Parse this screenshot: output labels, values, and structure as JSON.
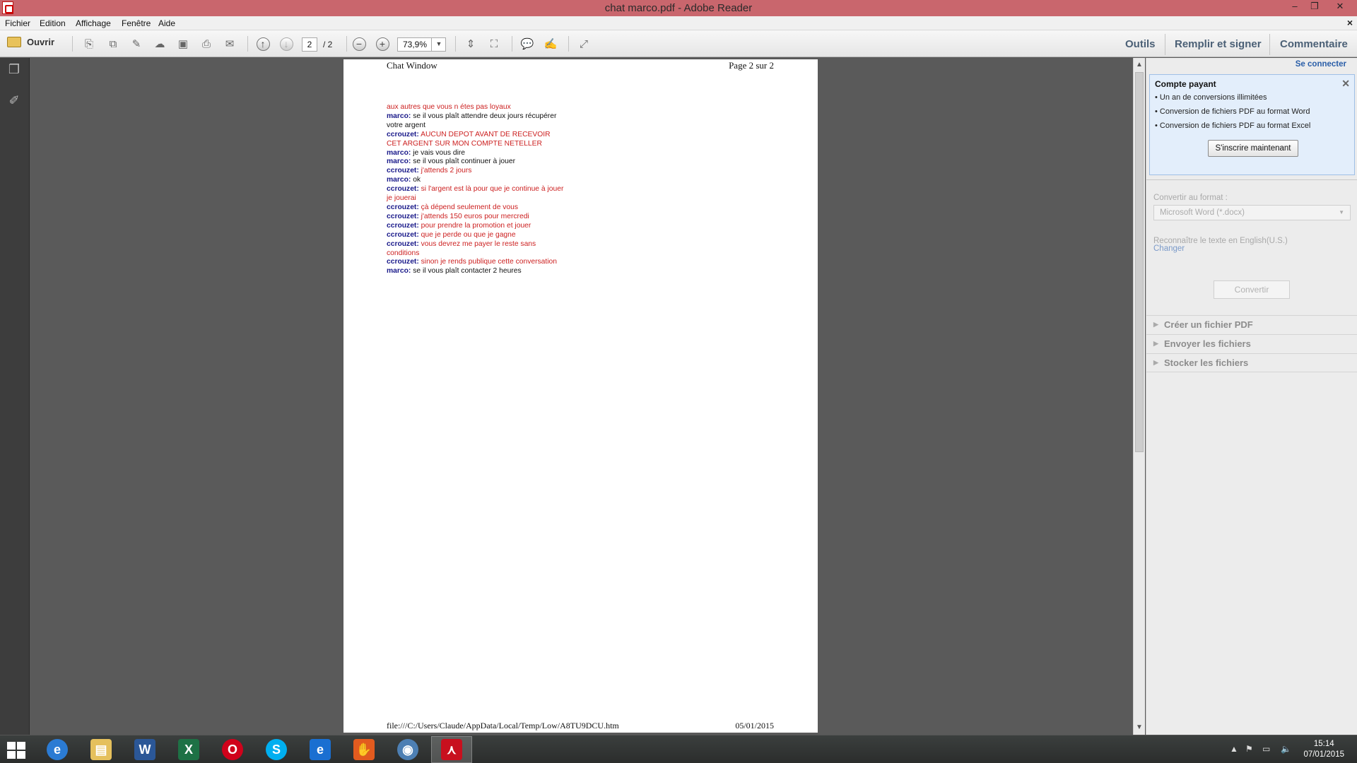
{
  "window": {
    "title": "chat marco.pdf - Adobe Reader",
    "min": "–",
    "restore": "❐",
    "close": "✕"
  },
  "menu": {
    "items": [
      "Fichier",
      "Edition",
      "Affichage",
      "Fenêtre",
      "Aide"
    ],
    "close_doc": "×"
  },
  "toolbar": {
    "open_label": "Ouvrir",
    "page_current": "2",
    "page_total": "/ 2",
    "zoom": "73,9%",
    "tabs": [
      "Outils",
      "Remplir et signer",
      "Commentaire"
    ]
  },
  "document": {
    "header_left": "Chat Window",
    "header_right": "Page 2 sur 2",
    "footer_left": "file:///C:/Users/Claude/AppData/Local/Temp/Low/A8TU9DCU.htm",
    "footer_right": "05/01/2015",
    "chat_lines": [
      {
        "who": "",
        "text": "aux autres que vous n étes pas loyaux",
        "style": "red"
      },
      {
        "who": "marco:",
        "text": " se il vous plaît attendre deux jours récupérer",
        "style": "black"
      },
      {
        "who": "",
        "text": "votre argent",
        "style": "black"
      },
      {
        "who": "ccrouzet:",
        "text": " AUCUN DEPOT AVANT DE RECEVOIR",
        "style": "red"
      },
      {
        "who": "",
        "text": "CET ARGENT SUR MON COMPTE NETELLER",
        "style": "red"
      },
      {
        "who": "marco:",
        "text": " je vais vous dire",
        "style": "black"
      },
      {
        "who": "marco:",
        "text": " se il vous plaît continuer à jouer",
        "style": "black"
      },
      {
        "who": "ccrouzet:",
        "text": " j'attends 2 jours",
        "style": "red"
      },
      {
        "who": "marco:",
        "text": " ok",
        "style": "black"
      },
      {
        "who": "ccrouzet:",
        "text": " si l'argent est là pour que je continue à jouer",
        "style": "red"
      },
      {
        "who": "",
        "text": "je jouerai",
        "style": "red"
      },
      {
        "who": "ccrouzet:",
        "text": " çà dépend seulement de vous",
        "style": "red"
      },
      {
        "who": "ccrouzet:",
        "text": " j'attends 150 euros pour mercredi",
        "style": "red"
      },
      {
        "who": "ccrouzet:",
        "text": " pour prendre la promotion et jouer",
        "style": "red"
      },
      {
        "who": "ccrouzet:",
        "text": " que je perde ou que je gagne",
        "style": "red"
      },
      {
        "who": "ccrouzet:",
        "text": " vous devrez me payer le reste sans",
        "style": "red"
      },
      {
        "who": "",
        "text": "conditions",
        "style": "red"
      },
      {
        "who": "ccrouzet:",
        "text": " sinon je rends publique cette conversation",
        "style": "red"
      },
      {
        "who": "marco:",
        "text": " se il vous plaît contacter 2 heures",
        "style": "black"
      }
    ]
  },
  "right_pane": {
    "sign_in": "Se connecter",
    "promo_title": "Compte payant",
    "promo_items": [
      "• Un an de conversions illimitées",
      "• Conversion de fichiers PDF au format Word",
      "• Conversion de fichiers PDF au format Excel"
    ],
    "promo_button": "S'inscrire maintenant",
    "convert_label": "Convertir au format :",
    "convert_select": "Microsoft Word (*.docx)",
    "recognize_label": "Reconnaître le texte en English(U.S.)",
    "change_link": "Changer",
    "convert_button": "Convertir",
    "sections": [
      "Créer un fichier PDF",
      "Envoyer les fichiers",
      "Stocker les fichiers"
    ]
  },
  "taskbar": {
    "time": "15:14",
    "date": "07/01/2015"
  }
}
